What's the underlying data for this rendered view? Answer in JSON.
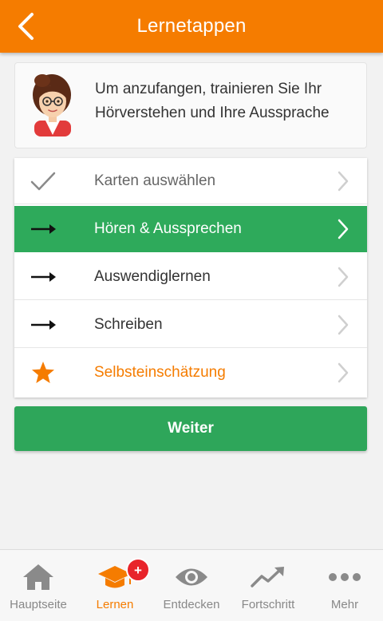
{
  "header": {
    "title": "Lernetappen"
  },
  "intro": {
    "text": "Um anzufangen, trainieren Sie Ihr Hörverstehen und Ihre Aussprache"
  },
  "steps": [
    {
      "label": "Karten auswählen",
      "state": "done",
      "icon": "checkmark-icon"
    },
    {
      "label": "Hören & Aussprechen",
      "state": "active",
      "icon": "arrow-right-icon"
    },
    {
      "label": "Auswendiglernen",
      "state": "pending",
      "icon": "arrow-right-icon"
    },
    {
      "label": "Schreiben",
      "state": "pending",
      "icon": "arrow-right-icon"
    },
    {
      "label": "Selbsteinschätzung",
      "state": "star",
      "icon": "star-icon"
    }
  ],
  "continue_button": {
    "label": "Weiter"
  },
  "bottom_nav": {
    "items": [
      {
        "label": "Hauptseite",
        "icon": "home-icon"
      },
      {
        "label": "Lernen",
        "icon": "graduation-cap-icon",
        "badge": "+"
      },
      {
        "label": "Entdecken",
        "icon": "eye-icon"
      },
      {
        "label": "Fortschritt",
        "icon": "trend-chart-icon"
      },
      {
        "label": "Mehr",
        "icon": "more-dots-icon"
      }
    ],
    "selected": "Lernen"
  },
  "colors": {
    "accent_orange": "#f57c00",
    "active_green": "#2eaa5b",
    "button_green": "#2ea65a",
    "badge_red": "#e8242b"
  }
}
